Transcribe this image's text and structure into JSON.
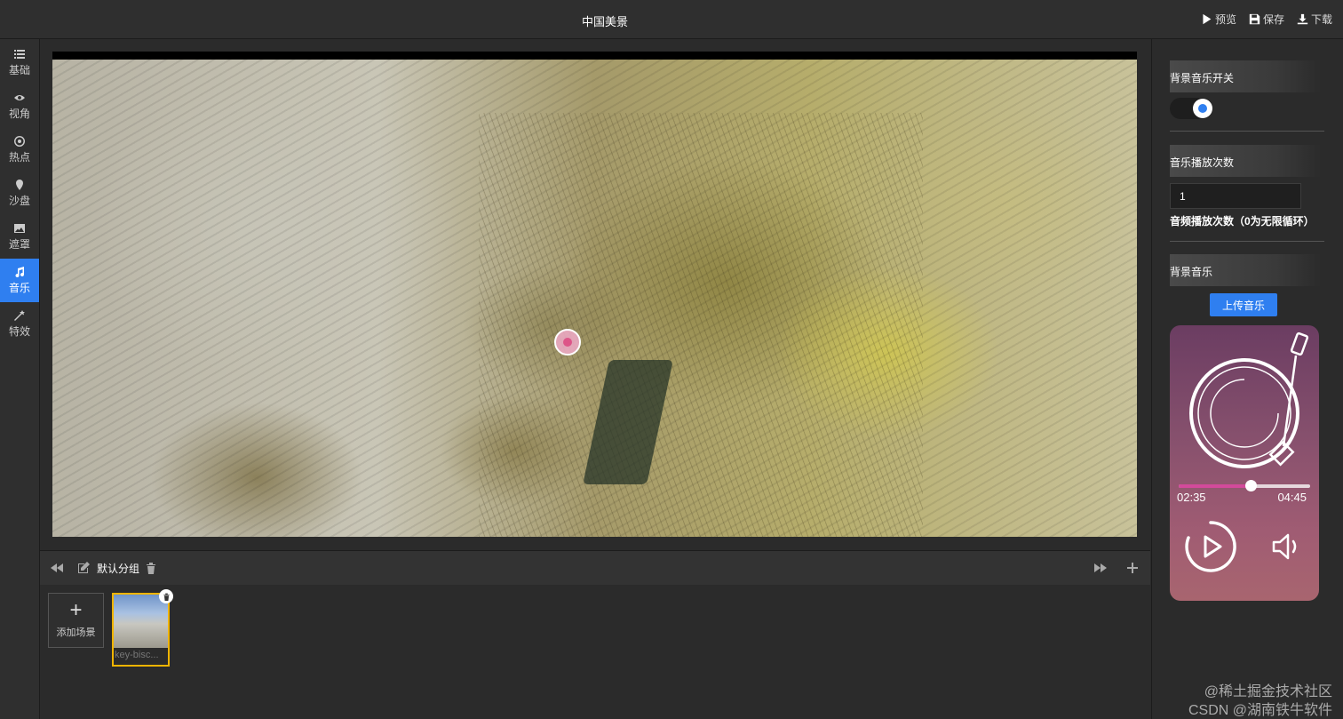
{
  "header": {
    "title": "中国美景",
    "actions": [
      {
        "label": "预览",
        "icon": "play-icon"
      },
      {
        "label": "保存",
        "icon": "save-icon"
      },
      {
        "label": "下载",
        "icon": "download-icon"
      }
    ]
  },
  "sidebar": {
    "items": [
      {
        "label": "基础",
        "icon": "list-icon",
        "active": false
      },
      {
        "label": "视角",
        "icon": "eye-icon",
        "active": false
      },
      {
        "label": "热点",
        "icon": "target-icon",
        "active": false
      },
      {
        "label": "沙盘",
        "icon": "map-pin-icon",
        "active": false
      },
      {
        "label": "遮罩",
        "icon": "image-icon",
        "active": false
      },
      {
        "label": "音乐",
        "icon": "music-icon",
        "active": true
      },
      {
        "label": "特效",
        "icon": "magic-wand-icon",
        "active": false
      }
    ]
  },
  "scenes": {
    "group_name": "默认分组",
    "add_label": "添加场景",
    "items": [
      {
        "name": "key-bisc..."
      }
    ]
  },
  "panel": {
    "bgm_switch_title": "背景音乐开关",
    "bgm_enabled": true,
    "play_count_title": "音乐播放次数",
    "play_count_value": "1",
    "play_count_hint": "音频播放次数（0为无限循环）",
    "bgm_title": "背景音乐",
    "upload_label": "上传音乐"
  },
  "player": {
    "current_time": "02:35",
    "total_time": "04:45",
    "progress": 0.55
  },
  "watermark": {
    "line1": "@稀土掘金技术社区",
    "line2": "CSDN @湖南铁牛软件"
  },
  "colors": {
    "accent": "#2f7ff0",
    "progress_fill": "#d34a9b",
    "scene_border": "#f0b400"
  }
}
